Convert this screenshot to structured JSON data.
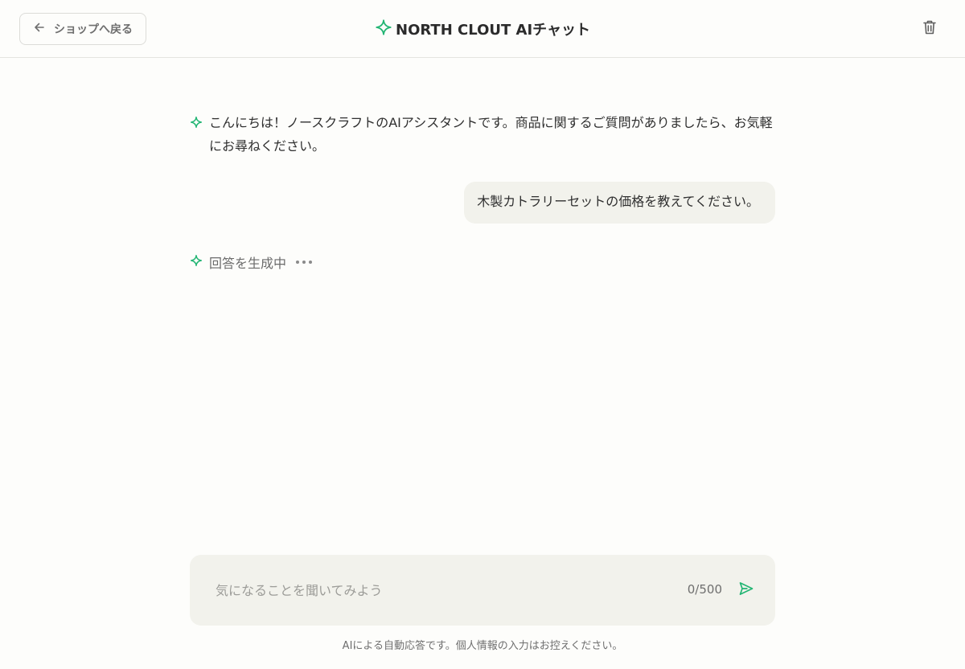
{
  "header": {
    "back_label": "ショップへ戻る",
    "title": "NORTH CLOUT AIチャット",
    "icons": {
      "back": "arrow-left-icon",
      "brand": "sparkle-icon",
      "clear": "trash-icon"
    }
  },
  "messages": [
    {
      "role": "assistant",
      "text": "こんにちは！ノースクラフトのAIアシスタントです。商品に関するご質問がありましたら、お気軽にお尋ねください。"
    },
    {
      "role": "user",
      "text": "木製カトラリーセットの価格を教えてください。"
    }
  ],
  "status": {
    "generating_text": "回答を生成中"
  },
  "composer": {
    "placeholder": "気になることを聞いてみよう",
    "value": "",
    "char_count": "0/500",
    "send_icon": "send-icon"
  },
  "footer": {
    "disclaimer": "AIによる自動応答です。個人情報の入力はお控えください。"
  },
  "colors": {
    "accent": "#22b573",
    "background": "#fdfdfb",
    "bubble": "#f2f2ec"
  }
}
